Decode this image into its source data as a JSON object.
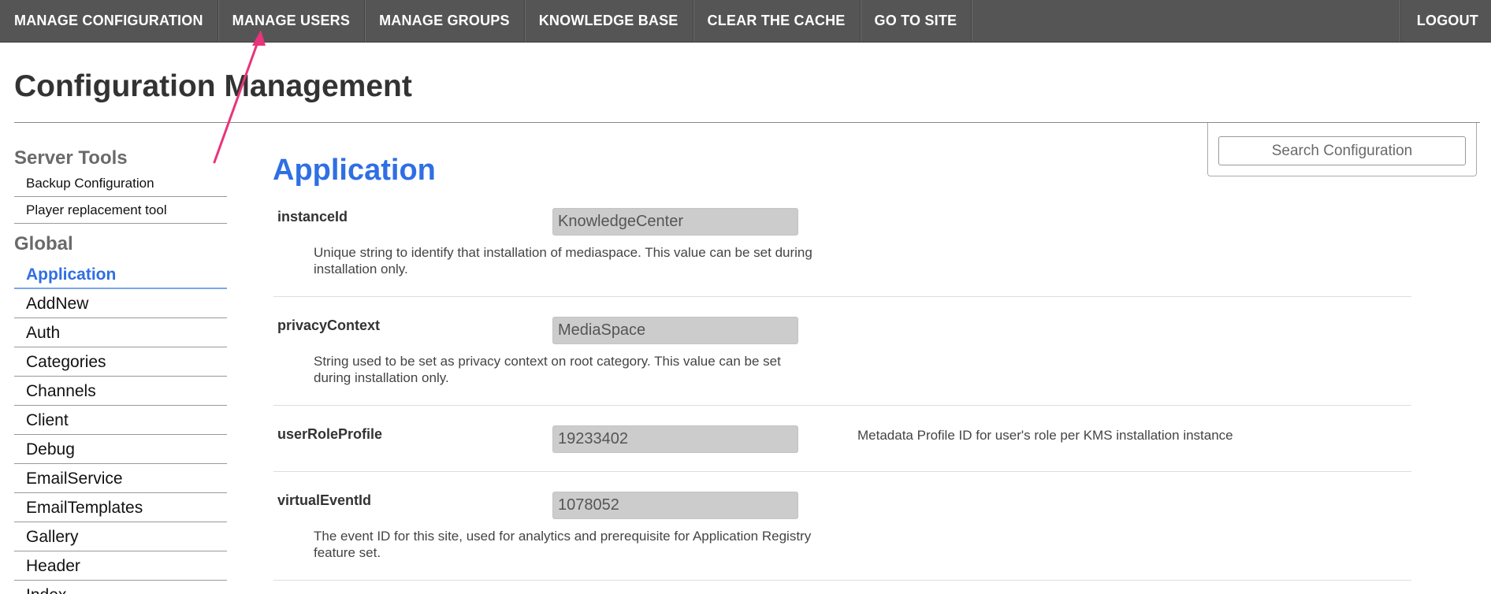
{
  "topnav": {
    "items": [
      {
        "label": "MANAGE CONFIGURATION"
      },
      {
        "label": "MANAGE USERS"
      },
      {
        "label": "MANAGE GROUPS"
      },
      {
        "label": "KNOWLEDGE BASE"
      },
      {
        "label": "CLEAR THE CACHE"
      },
      {
        "label": "GO TO SITE"
      }
    ],
    "logout": "LOGOUT"
  },
  "page_title": "Configuration Management",
  "search": {
    "placeholder": "Search Configuration"
  },
  "sidebar": {
    "server_tools_heading": "Server Tools",
    "server_tools": [
      {
        "label": "Backup Configuration"
      },
      {
        "label": "Player replacement tool"
      }
    ],
    "global_heading": "Global",
    "global_items": [
      {
        "label": "Application",
        "active": true
      },
      {
        "label": "AddNew"
      },
      {
        "label": "Auth"
      },
      {
        "label": "Categories"
      },
      {
        "label": "Channels"
      },
      {
        "label": "Client"
      },
      {
        "label": "Debug"
      },
      {
        "label": "EmailService"
      },
      {
        "label": "EmailTemplates"
      },
      {
        "label": "Gallery"
      },
      {
        "label": "Header"
      },
      {
        "label": "Index"
      }
    ]
  },
  "main": {
    "section_title": "Application",
    "configs": [
      {
        "key": "instanceId",
        "value": "KnowledgeCenter",
        "description": "Unique string to identify that installation of mediaspace. This value can be set during installation only."
      },
      {
        "key": "privacyContext",
        "value": "MediaSpace",
        "description": "String used to be set as privacy context on root category. This value can be set during installation only."
      },
      {
        "key": "userRoleProfile",
        "value": "19233402",
        "description": "Metadata Profile ID for user's role per KMS installation instance"
      },
      {
        "key": "virtualEventId",
        "value": "1078052",
        "description": "The event ID for this site, used for analytics and prerequisite for Application Registry feature set."
      }
    ]
  },
  "colors": {
    "nav_background": "#555555",
    "accent_blue": "#2f6fe4",
    "annotation_arrow": "#e8347a",
    "readonly_field": "#cccccc"
  }
}
